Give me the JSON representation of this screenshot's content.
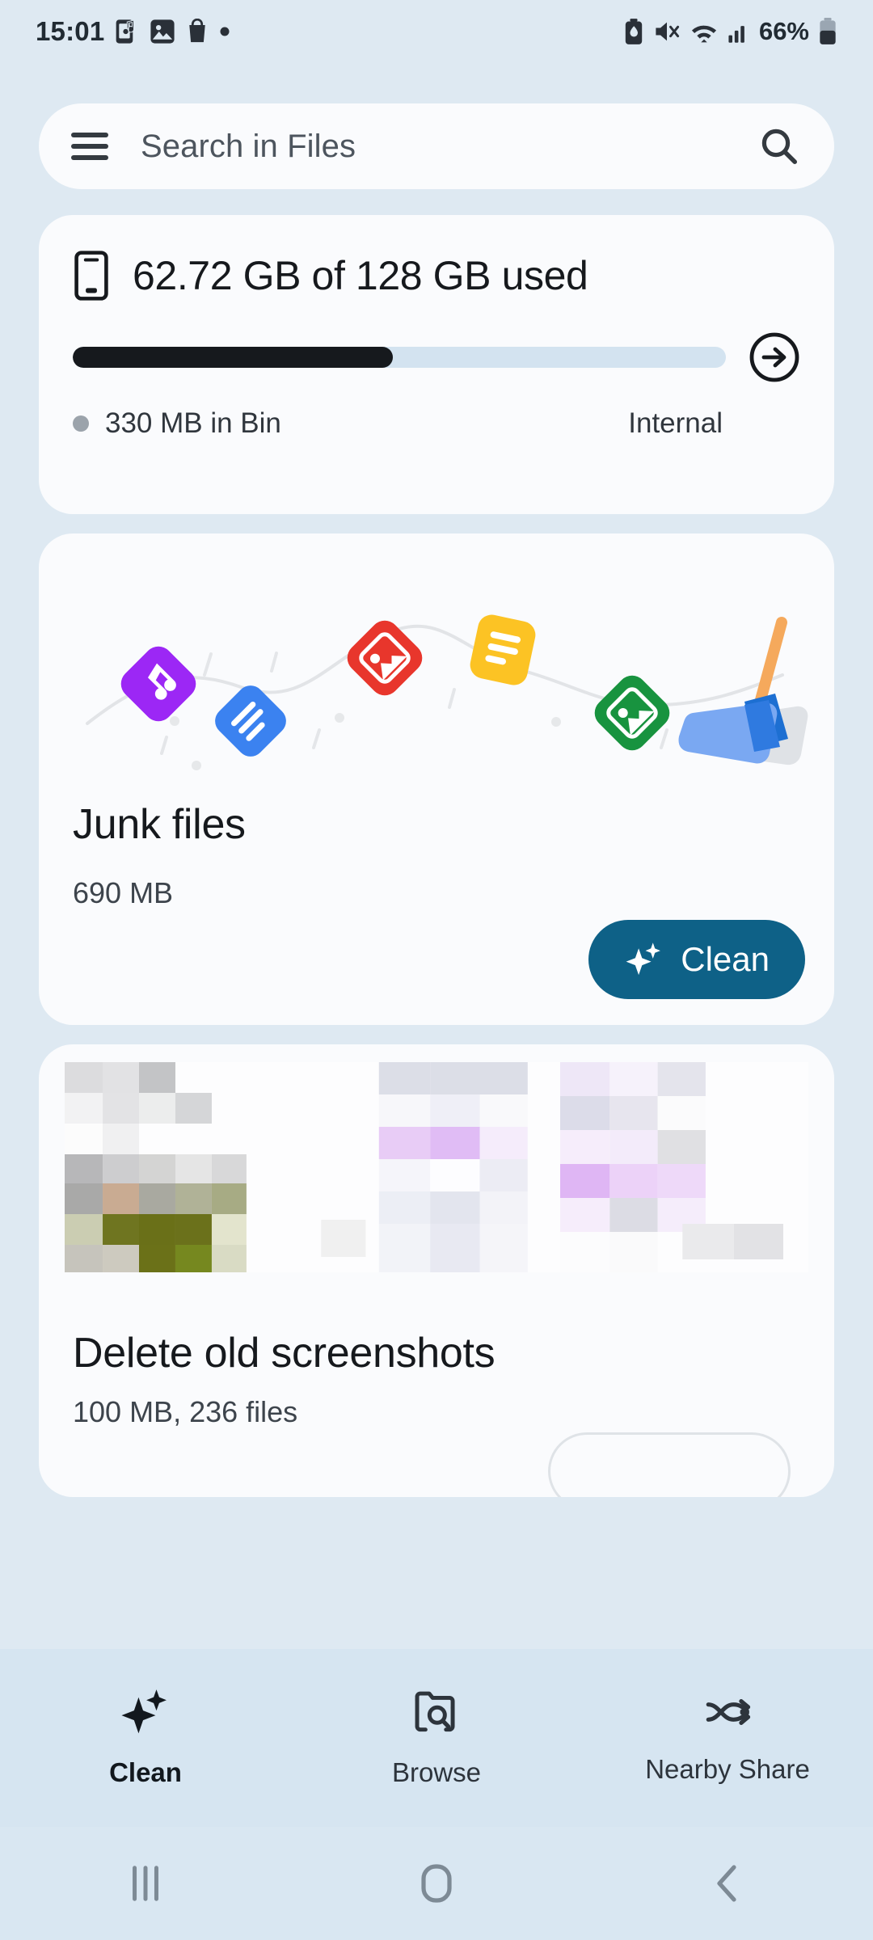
{
  "status_bar": {
    "time": "15:01",
    "left_icons": [
      "music-note-phone-icon",
      "photos-icon",
      "shopping-bag-icon",
      "dot-icon"
    ],
    "right_icons": [
      "battery-saver-icon",
      "mute-icon",
      "wifi-icon",
      "cellular-signal-icon"
    ],
    "battery_percent": "66%"
  },
  "search": {
    "menu_label": "menu",
    "placeholder": "Search in Files",
    "search_icon": "search-icon"
  },
  "storage": {
    "device_icon": "phone-icon",
    "title": "62.72 GB of 128 GB used",
    "used_gb": 62.72,
    "total_gb": 128,
    "fill_percent": 49,
    "bin_label": "330 MB in Bin",
    "volume_label": "Internal",
    "arrow_icon": "arrow-right-circle-icon",
    "bar_fill_color": "#16191d",
    "bar_track_color": "#d3e3f0"
  },
  "junk": {
    "title": "Junk files",
    "size": "690 MB",
    "clean_label": "Clean",
    "clean_icon": "sparkle-icon",
    "accent_color": "#0e6187",
    "illustration": "junk-files-broom-illustration"
  },
  "screenshots": {
    "title": "Delete old screenshots",
    "subtitle": "100 MB, 236 files",
    "thumbnails": [
      "screenshot-thumb-1",
      "screenshot-thumb-2",
      "screenshot-thumb-3"
    ]
  },
  "bottom_nav": {
    "items": [
      {
        "label": "Clean",
        "icon": "sparkle-icon",
        "active": true
      },
      {
        "label": "Browse",
        "icon": "folder-search-icon",
        "active": false
      },
      {
        "label": "Nearby Share",
        "icon": "nearby-share-icon",
        "active": false
      }
    ]
  },
  "android_nav": {
    "recents": "recents-icon",
    "home": "home-icon",
    "back": "back-icon"
  },
  "colors": {
    "page_background": "#dee9f2",
    "card_background": "#fafbfd",
    "nav_background": "#d6e5f1",
    "text_primary": "#16191d",
    "text_secondary": "#3d444c"
  }
}
